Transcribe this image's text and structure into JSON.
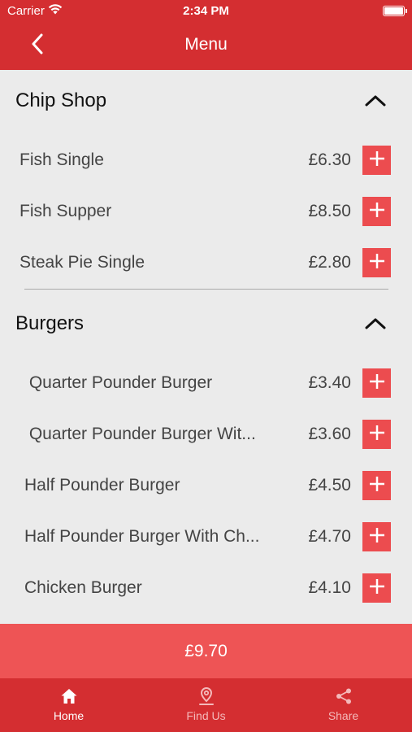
{
  "status": {
    "carrier": "Carrier",
    "time": "2:34 PM"
  },
  "nav": {
    "title": "Menu"
  },
  "sections": [
    {
      "name": "Chip Shop",
      "items": [
        {
          "name": "Fish Single",
          "price": "£6.30"
        },
        {
          "name": "Fish Supper",
          "price": "£8.50"
        },
        {
          "name": "Steak Pie Single",
          "price": "£2.80"
        }
      ]
    },
    {
      "name": "Burgers",
      "items": [
        {
          "name": " Quarter Pounder Burger",
          "price": "£3.40"
        },
        {
          "name": " Quarter Pounder Burger Wit...",
          "price": "£3.60"
        },
        {
          "name": "Half Pounder Burger",
          "price": "£4.50"
        },
        {
          "name": "Half Pounder Burger With Ch...",
          "price": "£4.70"
        },
        {
          "name": "Chicken Burger",
          "price": "£4.10"
        }
      ]
    }
  ],
  "cart": {
    "total": "£9.70"
  },
  "tabs": [
    {
      "label": "Home",
      "icon": "home-icon",
      "active": true
    },
    {
      "label": "Find Us",
      "icon": "location-icon",
      "active": false
    },
    {
      "label": "Share",
      "icon": "share-icon",
      "active": false
    }
  ],
  "colors": {
    "primary": "#d42e31",
    "cart": "#ee5455",
    "add_button": "#ec4c4f",
    "background": "#ebebeb"
  }
}
